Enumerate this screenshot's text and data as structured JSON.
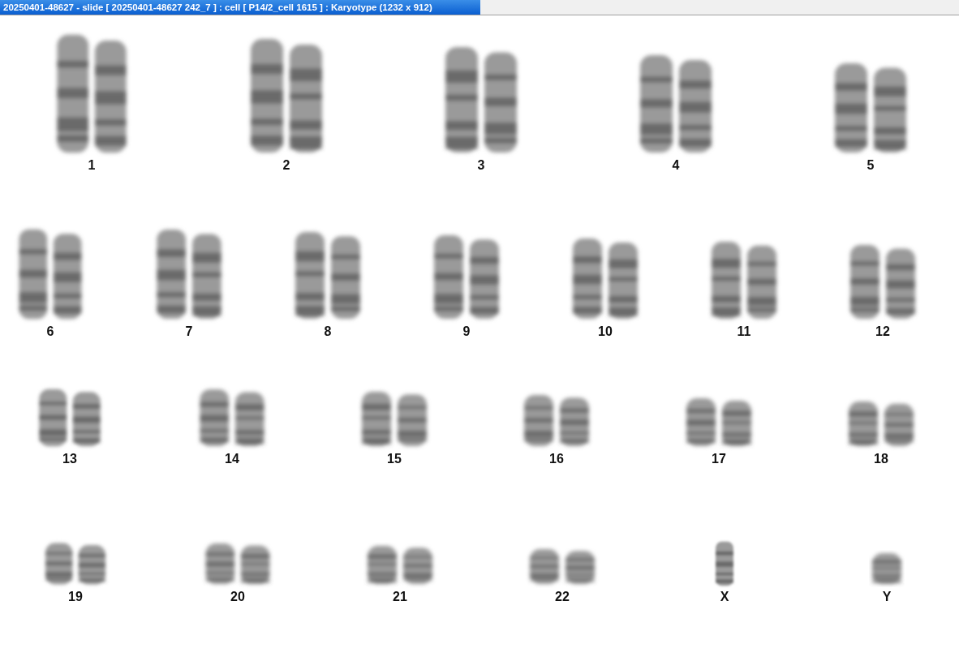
{
  "window": {
    "title": "20250401-48627 - slide [ 20250401-48627 242_7 ] : cell [ P14/2_cell 1615 ] : Karyotype  (1232 x 912)"
  },
  "rows": [
    [
      {
        "label": "1",
        "kind": "pair"
      },
      {
        "label": "2",
        "kind": "pair"
      },
      {
        "label": "3",
        "kind": "pair"
      },
      {
        "label": "4",
        "kind": "pair"
      },
      {
        "label": "5",
        "kind": "pair"
      }
    ],
    [
      {
        "label": "6",
        "kind": "pair"
      },
      {
        "label": "7",
        "kind": "pair"
      },
      {
        "label": "8",
        "kind": "pair"
      },
      {
        "label": "9",
        "kind": "pair"
      },
      {
        "label": "10",
        "kind": "pair"
      },
      {
        "label": "11",
        "kind": "pair"
      },
      {
        "label": "12",
        "kind": "pair"
      }
    ],
    [
      {
        "label": "13",
        "kind": "pair"
      },
      {
        "label": "14",
        "kind": "pair"
      },
      {
        "label": "15",
        "kind": "pair"
      },
      {
        "label": "16",
        "kind": "pair"
      },
      {
        "label": "17",
        "kind": "pair"
      },
      {
        "label": "18",
        "kind": "pair"
      }
    ],
    [
      {
        "label": "19",
        "kind": "pair"
      },
      {
        "label": "20",
        "kind": "pair"
      },
      {
        "label": "21",
        "kind": "pair"
      },
      {
        "label": "22",
        "kind": "pair"
      },
      {
        "label": "X",
        "kind": "single"
      },
      {
        "label": "Y",
        "kind": "single"
      }
    ]
  ]
}
